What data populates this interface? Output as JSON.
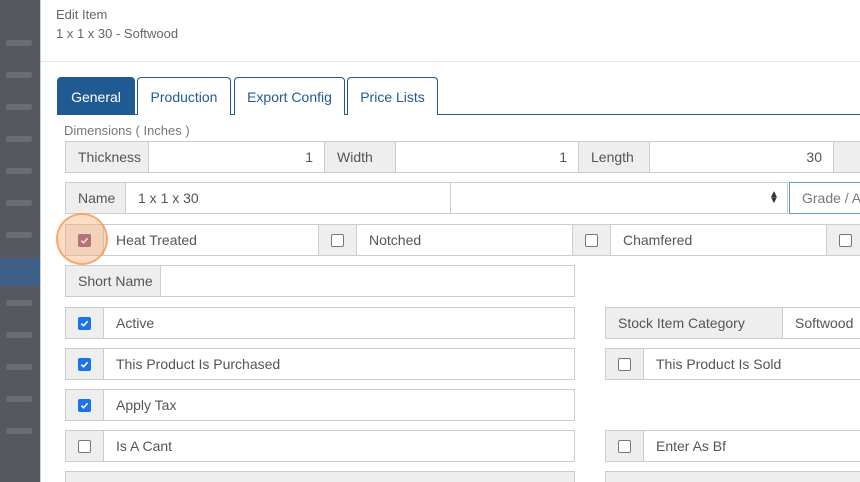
{
  "modal": {
    "title": "Edit Item",
    "subtitle": "1 x 1 x 30 - Softwood"
  },
  "tabs": [
    {
      "label": "General",
      "active": true
    },
    {
      "label": "Production",
      "active": false
    },
    {
      "label": "Export Config",
      "active": false
    },
    {
      "label": "Price Lists",
      "active": false
    }
  ],
  "dimensions": {
    "label": "Dimensions ( Inches )",
    "thickness_label": "Thickness",
    "thickness_value": "1",
    "width_label": "Width",
    "width_value": "1",
    "length_label": "Length",
    "length_value": "30"
  },
  "name_row": {
    "name_label": "Name",
    "name_value": "1 x 1 x 30",
    "grade_placeholder": "Grade / A"
  },
  "attributes": [
    {
      "label": "Heat Treated",
      "checked": true
    },
    {
      "label": "Notched",
      "checked": false
    },
    {
      "label": "Chamfered",
      "checked": false
    },
    {
      "label": "",
      "checked": false
    }
  ],
  "short_name": {
    "label": "Short Name",
    "value": ""
  },
  "flags_left": [
    {
      "label": "Active",
      "checked": true
    },
    {
      "label": "This Product Is Purchased",
      "checked": true
    },
    {
      "label": "Apply Tax",
      "checked": true
    },
    {
      "label": "Is A Cant",
      "checked": false
    }
  ],
  "stock_category": {
    "label": "Stock Item Category",
    "value": "Softwood"
  },
  "flags_right": [
    {
      "label": "This Product Is Sold",
      "checked": false
    },
    {
      "label": "Enter As Bf",
      "checked": false
    }
  ],
  "colors": {
    "accent": "#1f5a93",
    "checkbox": "#1a73e8",
    "highlight": "#f5964f"
  }
}
